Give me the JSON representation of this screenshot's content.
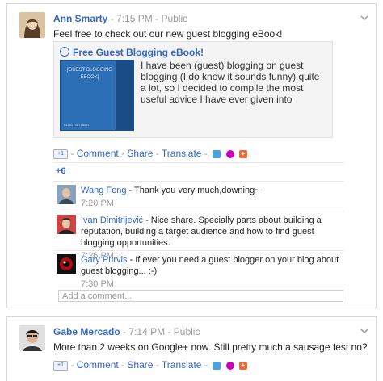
{
  "posts": [
    {
      "author": "Ann Smarty",
      "time": "7:15 PM",
      "visibility": "Public",
      "text": "Feel free to check out our new guest blogging eBook!",
      "attachment": {
        "title": "Free Guest Blogging eBook!",
        "description": "I have been (guest) blogging on guest blogging (I do know it sounds funny) quite a lot, so I decided to compile the most useful advice I have ever given into",
        "ebook_title": "[GUEST BLOGGING EBOOK]",
        "ebook_footer": "BLOG PARTNER"
      },
      "actions": {
        "plusone": "+1",
        "comment": "Comment",
        "share": "Share",
        "translate": "Translate",
        "separator": "-"
      },
      "plus_count": "+6",
      "comments": [
        {
          "author": "Wang Feng",
          "text": " - Thank you very much,downing~",
          "time": "7:20 PM"
        },
        {
          "author": "Ivan Dimitrijević",
          "text": " - Nice share. Specially parts about building a reputation, building a target audience and how to find guest blogging opportunities.",
          "time": "7:26 PM"
        },
        {
          "author": "Gary Purvis",
          "text": " - If ever you need a guest blogger on your blog about guest blogging... :-)",
          "time": "7:30 PM"
        }
      ],
      "add_comment_placeholder": "Add a comment..."
    },
    {
      "author": "Gabe Mercado",
      "time": "7:14 PM",
      "visibility": "Public",
      "text": "More than 2 weeks on Google+ now. Still pretty much a sausage fest no?",
      "actions": {
        "plusone": "+1",
        "comment": "Comment",
        "share": "Share",
        "translate": "Translate",
        "separator": "-"
      }
    }
  ],
  "meta_separator": "-",
  "icons": {
    "chevron": "chevron-down-icon",
    "twitter": "twitter-icon",
    "foursquare": "foursquare-icon",
    "addthis": "addthis-icon",
    "google_link": "google-link-icon"
  },
  "colors": {
    "link": "#3366cc",
    "muted": "#999999",
    "border": "#d8d8d8",
    "attachment_bg": "#f4f4f4",
    "ebook_blue": "#2d6fb5"
  }
}
